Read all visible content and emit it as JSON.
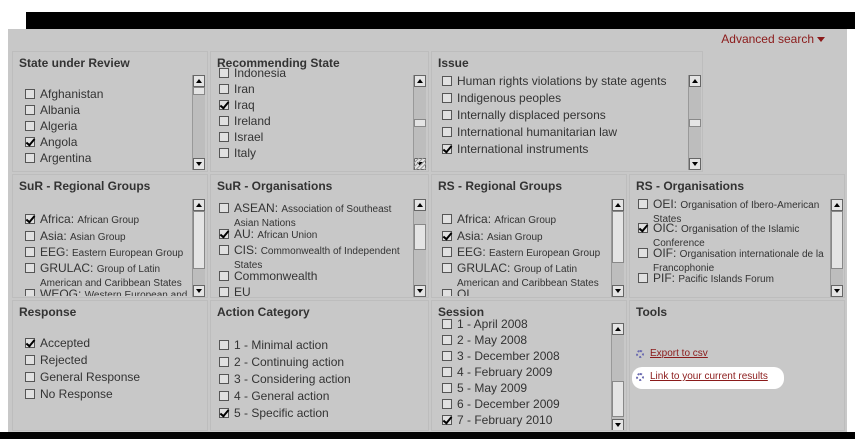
{
  "advanced_search": "Advanced search",
  "state_under_review": {
    "title": "State under Review",
    "items": [
      {
        "label": "Afghanistan",
        "checked": false
      },
      {
        "label": "Albania",
        "checked": false
      },
      {
        "label": "Algeria",
        "checked": false
      },
      {
        "label": "Angola",
        "checked": true
      },
      {
        "label": "Argentina",
        "checked": false
      }
    ]
  },
  "recommending_state": {
    "title": "Recommending State",
    "items": [
      {
        "label": "Indonesia",
        "checked": false
      },
      {
        "label": "Iran",
        "checked": false
      },
      {
        "label": "Iraq",
        "checked": true
      },
      {
        "label": "Ireland",
        "checked": false
      },
      {
        "label": "Israel",
        "checked": false
      },
      {
        "label": "Italy",
        "checked": false
      }
    ]
  },
  "issue": {
    "title": "Issue",
    "items": [
      {
        "label": "Human rights violations by state agents",
        "checked": false
      },
      {
        "label": "Indigenous peoples",
        "checked": false
      },
      {
        "label": "Internally displaced persons",
        "checked": false
      },
      {
        "label": "International humanitarian law",
        "checked": false
      },
      {
        "label": "International instruments",
        "checked": true
      }
    ]
  },
  "sur_regional_groups": {
    "title": "SuR - Regional Groups",
    "items": [
      {
        "code": "Africa",
        "desc": "African Group",
        "checked": true
      },
      {
        "code": "Asia",
        "desc": "Asian Group",
        "checked": false
      },
      {
        "code": "EEG",
        "desc": "Eastern European Group",
        "checked": false
      },
      {
        "code": "GRULAC",
        "desc": "Group of Latin American and Caribbean States",
        "checked": false
      },
      {
        "code": "WEOG",
        "desc": "Western European and",
        "checked": false
      }
    ]
  },
  "sur_organisations": {
    "title": "SuR - Organisations",
    "items": [
      {
        "code": "ASEAN",
        "desc": "Association of Southeast Asian Nations",
        "checked": false
      },
      {
        "code": "AU",
        "desc": "African Union",
        "checked": true
      },
      {
        "code": "CIS",
        "desc": "Commonwealth of Independent States",
        "checked": false
      },
      {
        "code": "Commonwealth",
        "desc": "",
        "checked": false
      },
      {
        "code": "EU",
        "desc": "",
        "checked": false
      }
    ]
  },
  "rs_regional_groups": {
    "title": "RS - Regional Groups",
    "items": [
      {
        "code": "Africa",
        "desc": "African Group",
        "checked": false
      },
      {
        "code": "Asia",
        "desc": "Asian Group",
        "checked": true
      },
      {
        "code": "EEG",
        "desc": "Eastern European Group",
        "checked": false
      },
      {
        "code": "GRULAC",
        "desc": "Group of Latin American and Caribbean States",
        "checked": false
      },
      {
        "code": "OL",
        "desc": "",
        "checked": false
      }
    ]
  },
  "rs_organisations": {
    "title": "RS - Organisations",
    "items": [
      {
        "code": "OEI",
        "desc": "Organisation of Ibero-American States",
        "checked": false
      },
      {
        "code": "OIC",
        "desc": "Organisation of the Islamic Conference",
        "checked": true
      },
      {
        "code": "OIF",
        "desc": "Organisation internationale de la Francophonie",
        "checked": false
      },
      {
        "code": "PIF",
        "desc": "Pacific Islands Forum",
        "checked": false
      }
    ]
  },
  "response": {
    "title": "Response",
    "items": [
      {
        "label": "Accepted",
        "checked": true
      },
      {
        "label": "Rejected",
        "checked": false
      },
      {
        "label": "General Response",
        "checked": false
      },
      {
        "label": "No Response",
        "checked": false
      }
    ]
  },
  "action_category": {
    "title": "Action Category",
    "items": [
      {
        "label": "1 - Minimal action",
        "checked": false
      },
      {
        "label": "2 - Continuing action",
        "checked": false
      },
      {
        "label": "3 - Considering action",
        "checked": false
      },
      {
        "label": "4 - General action",
        "checked": false
      },
      {
        "label": "5 - Specific action",
        "checked": true
      }
    ]
  },
  "session": {
    "title": "Session",
    "items": [
      {
        "label": "1 - April 2008",
        "checked": false
      },
      {
        "label": "2 - May 2008",
        "checked": false
      },
      {
        "label": "3 - December 2008",
        "checked": false
      },
      {
        "label": "4 - February 2009",
        "checked": false
      },
      {
        "label": "5 - May 2009",
        "checked": false
      },
      {
        "label": "6 - December 2009",
        "checked": false
      },
      {
        "label": "7 - February 2010",
        "checked": true
      }
    ]
  },
  "tools": {
    "title": "Tools",
    "export_csv": "Export to csv",
    "link_results": "Link to your current results"
  },
  "colors": {
    "link": "#8b1a1a",
    "panel_bg": "#c8c8c8"
  }
}
